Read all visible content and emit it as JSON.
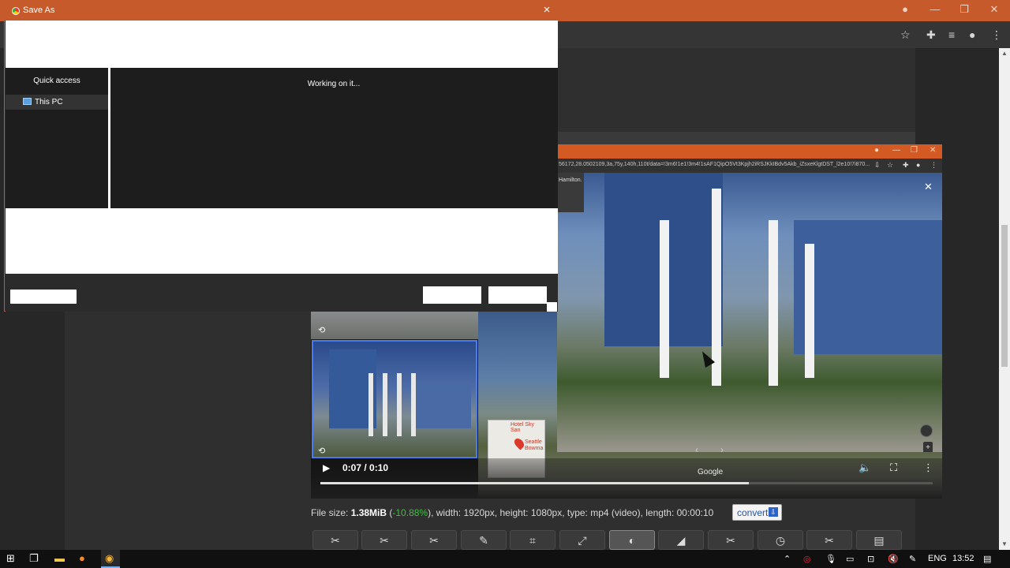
{
  "dialog": {
    "title": "Save As",
    "close_icon": "×",
    "sidebar": {
      "heading": "Quick access",
      "items": [
        {
          "label": "This PC",
          "icon": "computer-icon"
        }
      ]
    },
    "content_status": "Working on it..."
  },
  "browser_background": {
    "window_controls": {
      "minimize": "—",
      "maximize": "❐",
      "close": "✕"
    }
  },
  "street_view": {
    "url": "56172,28.0502109,3a,75y,140h,110t/data=!3m6!1e1!3m4!1sAF1QipO5Vt3Kpjh2iRSJKkIBdv5Akb_iZsxeKlgtDST_l2e10!7i870...",
    "side_text": "Hamilton.",
    "watermark": "Google",
    "map_labels": [
      "Hotel Sky San",
      "Seattle",
      "Bowma"
    ]
  },
  "video": {
    "time": "0:07 / 0:10",
    "progress_fraction": 0.7
  },
  "file_info": {
    "prefix": "File size: ",
    "size": "1.38MiB",
    "open_paren": " (",
    "percent": "-10.88%",
    "rest": "), width: 1920px, height: 1080px, type: mp4 (video), length: 00:00:10",
    "convert_label": "convert"
  },
  "taskbar": {
    "language": "ENG",
    "time": "13:52"
  }
}
